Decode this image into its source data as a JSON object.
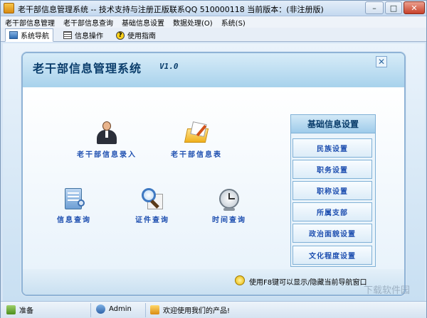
{
  "window": {
    "title": "老干部信息管理系统 -- 技术支持与注册正版联系QQ 510000118   当前版本：(非注册版)",
    "controls": {
      "minimize": "–",
      "maximize": "□",
      "close": "✕"
    }
  },
  "menubar": {
    "items": [
      "老干部信息管理",
      "老干部信息查询",
      "基础信息设置",
      "数据处理(O)",
      "系统(S)"
    ]
  },
  "tabs": [
    {
      "label": "系统导航",
      "icon": "monitor-icon"
    },
    {
      "label": "信息操作",
      "icon": "grid-icon"
    },
    {
      "label": "使用指南",
      "icon": "help-icon",
      "glyph": "?"
    }
  ],
  "panel": {
    "title": "老干部信息管理系统",
    "version": "V1.0",
    "close": "✕",
    "features": [
      {
        "label": "老干部信息录入",
        "icon": "person-icon"
      },
      {
        "label": "老干部信息表",
        "icon": "folder-icon"
      },
      {
        "label": "信息查询",
        "icon": "document-icon"
      },
      {
        "label": "证件查询",
        "icon": "search-icon"
      },
      {
        "label": "时间查询",
        "icon": "clock-icon"
      }
    ],
    "side": {
      "header": "基础信息设置",
      "buttons": [
        "民族设置",
        "职务设置",
        "职称设置",
        "所属支部",
        "政治面貌设置",
        "文化程度设置"
      ]
    },
    "tip": "使用F8键可以显示/隐藏当前导航窗口"
  },
  "statusbar": {
    "ready": "准备",
    "user": "Admin",
    "welcome": "欢迎使用我们的产品!"
  },
  "watermark": "下载软件园"
}
